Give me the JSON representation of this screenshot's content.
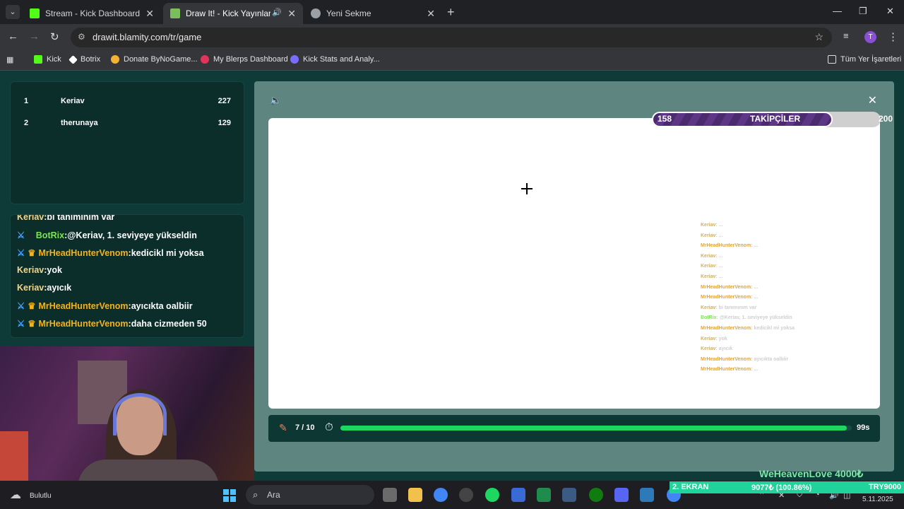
{
  "browser": {
    "tabs": [
      {
        "title": "Stream - Kick Dashboard",
        "favicon_color": "#53fc18"
      },
      {
        "title": "Draw It! - Kick Yayınları İçin",
        "favicon_color": "#7bbf5c"
      },
      {
        "title": "Yeni Sekme",
        "favicon_color": "#9aa0a6"
      }
    ],
    "url": "drawit.blamity.com/tr/game",
    "profile_initial": "T",
    "bookmarks": [
      {
        "label": "Kick",
        "color": "#53fc18"
      },
      {
        "label": "Botrix",
        "color": "#ffffff"
      },
      {
        "label": "Donate ByNoGame...",
        "color": "#f2b233"
      },
      {
        "label": "My Blerps Dashboard",
        "color": "#e2345a"
      },
      {
        "label": "Kick Stats and Analy...",
        "color": "#7a6cff"
      }
    ],
    "all_bookmarks": "Tüm Yer İşaretleri"
  },
  "leaderboard": [
    {
      "rank": "1",
      "name": "Keriav",
      "score": "227"
    },
    {
      "rank": "2",
      "name": "therunaya",
      "score": "129"
    }
  ],
  "chat": [
    {
      "user": "Keriav",
      "text": "bi tanımınım var",
      "badges": "none",
      "color": "#f2d68a"
    },
    {
      "user": "BotRix",
      "text": "@Keriav, 1. seviyeye yükseldin",
      "badges": "bot",
      "color": "#7ee25a"
    },
    {
      "user": "MrHeadHunterVenom",
      "text": "kedicikl mi yoksa",
      "badges": "mod",
      "color": "#f5b21a"
    },
    {
      "user": "Keriav",
      "text": "yok",
      "badges": "none",
      "color": "#f2d68a"
    },
    {
      "user": "Keriav",
      "text": "ayıcık",
      "badges": "none",
      "color": "#f2d68a"
    },
    {
      "user": "MrHeadHunterVenom",
      "text": "ayıcıkta oalbiir",
      "badges": "mod",
      "color": "#f5b21a"
    },
    {
      "user": "MrHeadHunterVenom",
      "text": "daha cizmeden 50",
      "badges": "mod",
      "color": "#f5b21a"
    }
  ],
  "followers": {
    "label": "TAKİPÇİLER",
    "current": "158",
    "goal": "200",
    "fraction": 0.79
  },
  "round": {
    "label": "7 / 10"
  },
  "timer": {
    "label": "99s",
    "fraction": 0.99
  },
  "overlay_chat": [
    {
      "user": "Keriav",
      "text": ": ...",
      "kind": "plain"
    },
    {
      "user": "Keriav",
      "text": ": ...",
      "kind": "plain"
    },
    {
      "user": "MrHeadHunterVenom",
      "text": ": ...",
      "kind": "mod"
    },
    {
      "user": "Keriav",
      "text": ": ...",
      "kind": "plain"
    },
    {
      "user": "Keriav",
      "text": ": ...",
      "kind": "plain"
    },
    {
      "user": "Keriav",
      "text": ": ...",
      "kind": "plain"
    },
    {
      "user": "MrHeadHunterVenom",
      "text": ": ...",
      "kind": "mod"
    },
    {
      "user": "MrHeadHunterVenom",
      "text": ": ...",
      "kind": "mod"
    },
    {
      "user": "Keriav",
      "text": ": bi tanımınım var",
      "kind": "plain"
    },
    {
      "user": "BotRix",
      "text": ": @Keriav, 1. seviyeye yükseldin",
      "kind": "bot"
    },
    {
      "user": "MrHeadHunterVenom",
      "text": ": kedicikl mi yoksa",
      "kind": "mod"
    },
    {
      "user": "Keriav",
      "text": ": yok",
      "kind": "plain"
    },
    {
      "user": "Keriav",
      "text": ": ayıcık",
      "kind": "plain"
    },
    {
      "user": "MrHeadHunterVenom",
      "text": ": ayıcıkta oalbiir",
      "kind": "mod"
    },
    {
      "user": "MrHeadHunterVenom",
      "text": ": ...",
      "kind": "mod"
    }
  ],
  "donation": "WeHeavenLove 4000₺",
  "ticker": {
    "left": "2. EKRAN",
    "mid": "9077₺ (100.86%)",
    "right": "TRY9000"
  },
  "taskbar": {
    "weather": "Bulutlu",
    "search_label": "Ara",
    "date": "5.11.2025"
  }
}
